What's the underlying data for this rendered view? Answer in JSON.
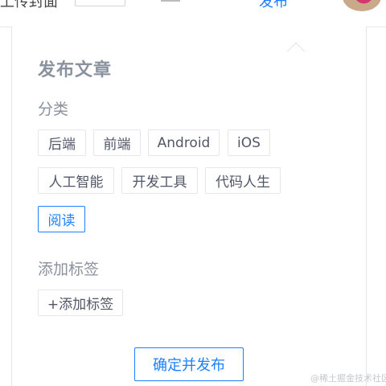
{
  "header": {
    "left_text": "上传封面",
    "link_text": "发布",
    "accent_color": "#1e80ff"
  },
  "panel": {
    "title": "发布文章",
    "category_label": "分类",
    "categories": [
      "后端",
      "前端",
      "Android",
      "iOS",
      "人工智能",
      "开发工具",
      "代码人生",
      "阅读"
    ],
    "selected_category": "阅读",
    "tags_label": "添加标签",
    "add_tag_button": "+添加标签",
    "confirm_button": "确定并发布"
  },
  "watermark": "@稀土掘金技术社区"
}
